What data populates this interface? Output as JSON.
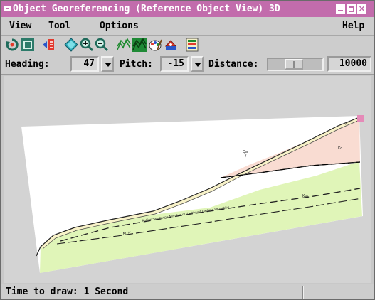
{
  "window": {
    "title": "Object Georeferencing (Reference Object View) 3D",
    "controls": {
      "minimize_icon": "minimize-icon",
      "maximize_icon": "maximize-icon",
      "close_label": "×"
    }
  },
  "menubar": {
    "view": "View",
    "tool": "Tool",
    "options": "Options",
    "help": "Help"
  },
  "toolbar": {
    "buttons": [
      {
        "name": "rotate-view-icon"
      },
      {
        "name": "full-view-icon"
      },
      {
        "name": "add-point-icon"
      },
      {
        "name": "diamond-icon"
      },
      {
        "name": "zoom-in-icon"
      },
      {
        "name": "zoom-out-icon"
      },
      {
        "name": "wireframe-icon"
      },
      {
        "name": "solid-surface-icon"
      },
      {
        "name": "paint-icon"
      },
      {
        "name": "color-fill-icon"
      },
      {
        "name": "layer-controls-icon"
      }
    ]
  },
  "controls": {
    "heading_label": "Heading:",
    "heading_value": "47",
    "pitch_label": "Pitch:",
    "pitch_value": "-15",
    "distance_label": "Distance:",
    "distance_value": "10000",
    "distance_slider_fraction": 0.45
  },
  "scene_labels": {
    "unit_a": "Qal",
    "unit_b": "Kc",
    "unit_c": "Kmv",
    "unit_d": "Kpc",
    "sandstone_label": "Rollins Sandstone Member of the Mount Garfield Formation",
    "summit_label": "Qc"
  },
  "colors": {
    "title_bar": "#c26cac",
    "lower_unit": "#e0f5b8",
    "upper_unit": "#f9dcd2",
    "sandstone_band": "#f8f2c8"
  },
  "status": {
    "text": "Time to draw: 1 Second"
  }
}
